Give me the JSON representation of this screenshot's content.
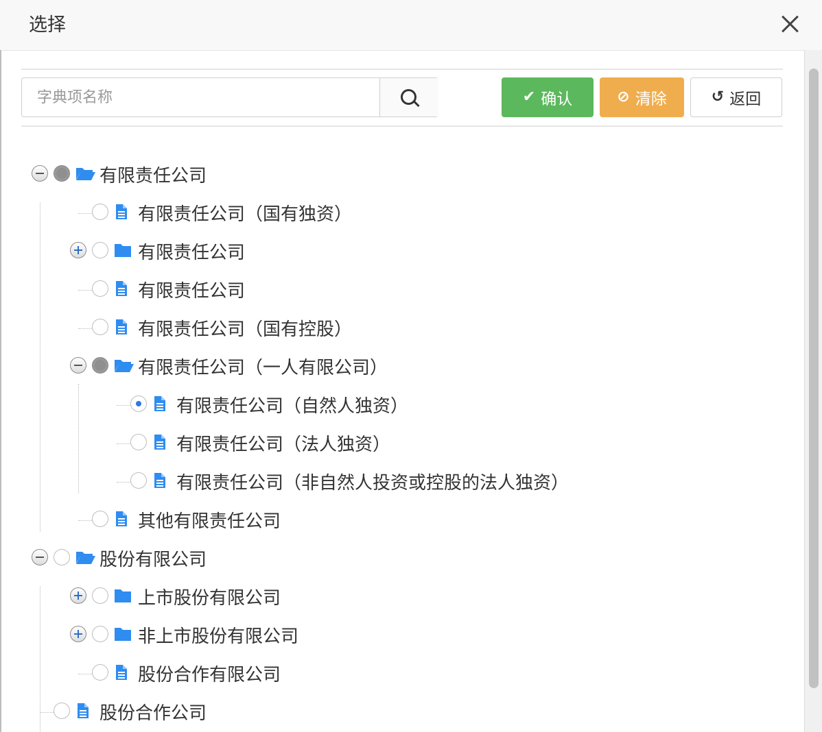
{
  "dialog": {
    "title": "选择"
  },
  "search": {
    "placeholder": "字典项名称"
  },
  "buttons": {
    "confirm": "确认",
    "clear": "清除",
    "back": "返回"
  },
  "colors": {
    "confirm_bg": "#5cb85c",
    "clear_bg": "#f0ad4e",
    "folder_icon": "#2f8cf0",
    "radio_checked": "#2a7ae2"
  },
  "tree": [
    {
      "id": "n0",
      "label": "有限责任公司",
      "icon": "folder-open",
      "state": "partial",
      "toggle": "minus"
    },
    {
      "id": "n1",
      "label": "有限责任公司（国有独资）",
      "icon": "file",
      "state": "none"
    },
    {
      "id": "n2",
      "label": "有限责任公司",
      "icon": "folder",
      "state": "none",
      "toggle": "plus"
    },
    {
      "id": "n3",
      "label": "有限责任公司",
      "icon": "file",
      "state": "none"
    },
    {
      "id": "n4",
      "label": "有限责任公司（国有控股）",
      "icon": "file",
      "state": "none"
    },
    {
      "id": "n5",
      "label": "有限责任公司（一人有限公司）",
      "icon": "folder-open",
      "state": "partial",
      "toggle": "minus"
    },
    {
      "id": "n6",
      "label": "有限责任公司（自然人独资）",
      "icon": "file",
      "state": "checked"
    },
    {
      "id": "n7",
      "label": "有限责任公司（法人独资）",
      "icon": "file",
      "state": "none"
    },
    {
      "id": "n8",
      "label": "有限责任公司（非自然人投资或控股的法人独资）",
      "icon": "file",
      "state": "none"
    },
    {
      "id": "n9",
      "label": "其他有限责任公司",
      "icon": "file",
      "state": "none"
    },
    {
      "id": "n10",
      "label": "股份有限公司",
      "icon": "folder-open",
      "state": "none",
      "toggle": "minus"
    },
    {
      "id": "n11",
      "label": "上市股份有限公司",
      "icon": "folder",
      "state": "none",
      "toggle": "plus"
    },
    {
      "id": "n12",
      "label": "非上市股份有限公司",
      "icon": "folder",
      "state": "none",
      "toggle": "plus"
    },
    {
      "id": "n13",
      "label": "股份合作有限公司",
      "icon": "file",
      "state": "none"
    },
    {
      "id": "n14",
      "label": "股份合作公司",
      "icon": "file",
      "state": "none"
    }
  ]
}
